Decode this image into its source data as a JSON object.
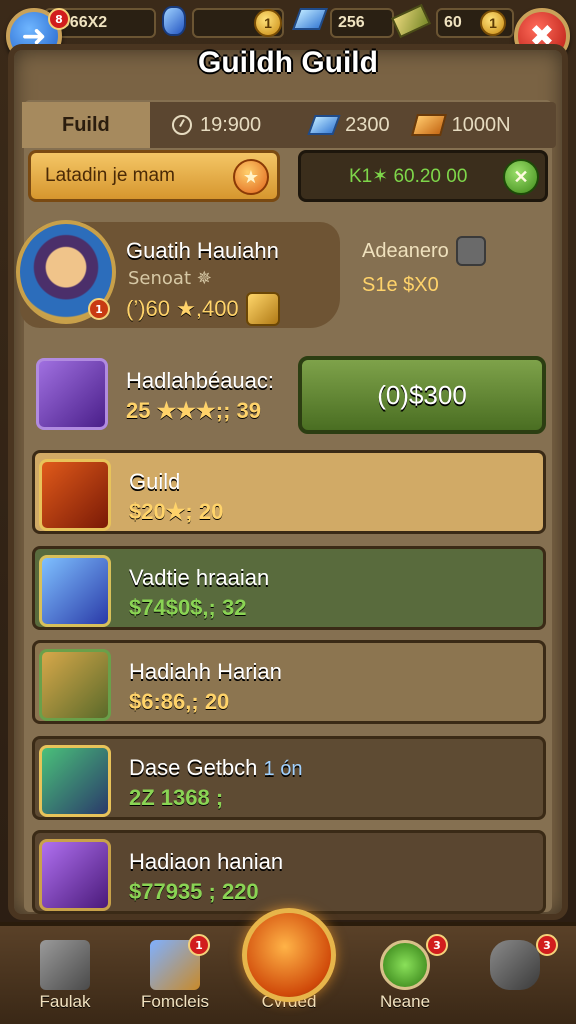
{
  "resources": {
    "player_level": "3966X2",
    "gems_icon": "blue-gem-icon",
    "coins_value": "1",
    "crystals_value": "256",
    "gold_value": "60",
    "gold_coin": "1",
    "back_badge": "8"
  },
  "title": "Guildh Guild",
  "info_bar": {
    "tab_label": "Fuild",
    "timer": "19:900",
    "crystals": "2300",
    "gold": "1000N"
  },
  "search": {
    "value": "Latadin je mam",
    "code": "K1✶ 60.20 00"
  },
  "leader": {
    "name": "Guatih Hauiahn",
    "rank": "Senoat ✵",
    "score": "(’)60 ★,400",
    "side_title": "Adeanero",
    "side_value": "S1e $X0",
    "badge": "1"
  },
  "join_button": "(0)$300",
  "rows": [
    {
      "name": "Hadlahbéauac:",
      "value": "25 ★★★;; 39",
      "value_color": "#ffd36a",
      "bg": "#7b6446",
      "icon": "mask-icon",
      "icon_bg": "#7a3fb8"
    },
    {
      "name": "Guild",
      "value": "$20★; 20",
      "value_color": "#ffd36a",
      "bg": "#cfa864",
      "icon": "sword-icon",
      "icon_bg": "#c04a1a"
    },
    {
      "name": "Vadtie hraaian",
      "value": "$74$0$,; 32",
      "value_color": "#8ad454",
      "bg": "#596b3d",
      "icon": "crystal-blade-icon",
      "icon_bg": "#2a5aa8"
    },
    {
      "name": "Hadiahh Harian",
      "value": "$6:86,; 20",
      "value_color": "#ffd36a",
      "bg": "#8a744f",
      "icon": "golden-mask-icon",
      "icon_bg": "#4a6a2a"
    },
    {
      "name": "Dase Getbch",
      "value": "2Z 1368 ;",
      "value_color": "#8ad454",
      "bg": "#5e4b33",
      "icon": "staff-icon",
      "icon_bg": "#3a6a4a"
    },
    {
      "name": "Hadiaon hanian",
      "value": "$77935 ; 220",
      "value_color": "#8ad454",
      "bg": "#5a4630",
      "icon": "scroll-icon",
      "icon_bg": "#6a2a8a"
    }
  ],
  "row4_extra": "1 ón",
  "nav": [
    {
      "label": "Faulak",
      "icon": "anvil-icon",
      "badge": ""
    },
    {
      "label": "Fomcleis",
      "icon": "forge-icon",
      "badge": "1"
    },
    {
      "label": "Cvrded",
      "icon": "guild-crest-icon",
      "badge": ""
    },
    {
      "label": "Neane",
      "icon": "sword-circle-icon",
      "badge": "3"
    },
    {
      "label": "",
      "icon": "ore-icon",
      "badge": "3"
    }
  ],
  "colors": {
    "panel": "#857051",
    "accent_gold": "#ffd36a",
    "accent_green": "#8ad454",
    "close_red": "#b3160e",
    "back_blue": "#1e5ec8"
  }
}
